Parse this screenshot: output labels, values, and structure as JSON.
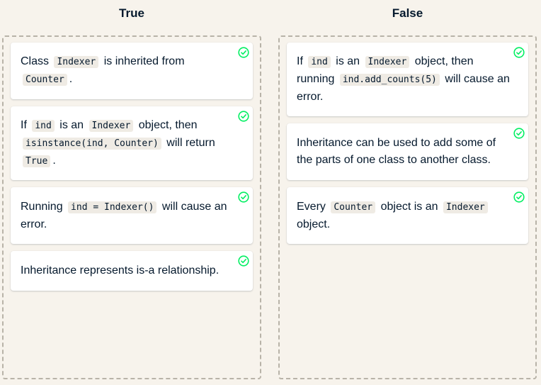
{
  "columns": [
    {
      "title": "True",
      "cards": [
        {
          "segments": [
            {
              "t": "Class "
            },
            {
              "c": "Indexer"
            },
            {
              "t": " is inherited from "
            },
            {
              "c": "Counter"
            },
            {
              "t": "."
            }
          ]
        },
        {
          "segments": [
            {
              "t": "If "
            },
            {
              "c": "ind"
            },
            {
              "t": " is an "
            },
            {
              "c": "Indexer"
            },
            {
              "t": " object, then "
            },
            {
              "c": "isinstance(ind, Counter)"
            },
            {
              "t": " will return "
            },
            {
              "c": "True"
            },
            {
              "t": "."
            }
          ]
        },
        {
          "segments": [
            {
              "t": "Running "
            },
            {
              "c": "ind = Indexer()"
            },
            {
              "t": " will cause an error."
            }
          ]
        },
        {
          "segments": [
            {
              "t": "Inheritance represents is-a relationship."
            }
          ]
        }
      ]
    },
    {
      "title": "False",
      "cards": [
        {
          "segments": [
            {
              "t": "If "
            },
            {
              "c": "ind"
            },
            {
              "t": " is an "
            },
            {
              "c": "Indexer"
            },
            {
              "t": " object, then running "
            },
            {
              "c": "ind.add_counts(5)"
            },
            {
              "t": " will cause an error."
            }
          ]
        },
        {
          "segments": [
            {
              "t": "Inheritance can be used to add some of the parts of one class to another class."
            }
          ]
        },
        {
          "segments": [
            {
              "t": "Every "
            },
            {
              "c": "Counter"
            },
            {
              "t": " object is an "
            },
            {
              "c": "Indexer"
            },
            {
              "t": " object."
            }
          ]
        }
      ]
    }
  ],
  "check_icon": "check-circle-icon",
  "colors": {
    "background": "#f7f3ec",
    "card": "#ffffff",
    "text": "#05192d",
    "check": "#03ef62",
    "code_bg": "#efebe4",
    "dashed_border": "#b8b3a8"
  }
}
